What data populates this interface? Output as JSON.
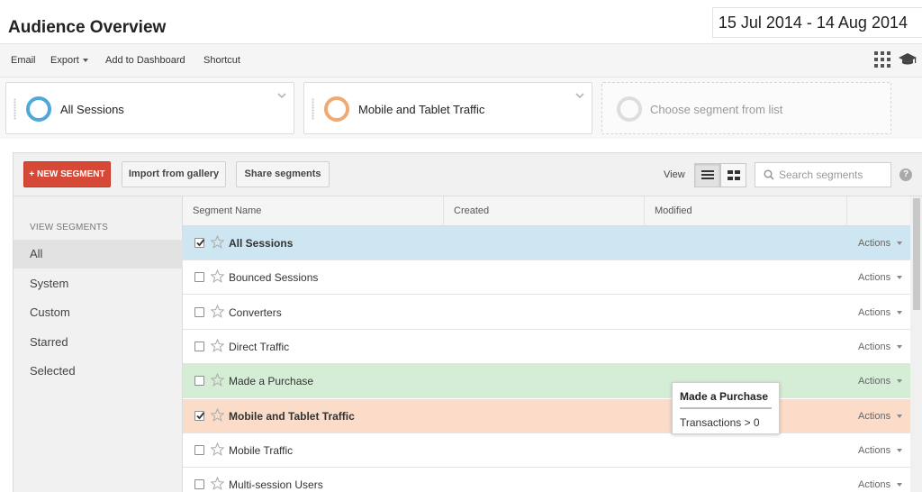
{
  "header": {
    "title": "Audience Overview",
    "date_range": "15 Jul 2014 - 14 Aug 2014"
  },
  "toolbar": {
    "email": "Email",
    "export": "Export",
    "add_to_dashboard": "Add to Dashboard",
    "shortcut": "Shortcut"
  },
  "segments": [
    {
      "label": "All Sessions",
      "color": "#4fa8d8"
    },
    {
      "label": "Mobile and Tablet Traffic",
      "color": "#f0a971"
    },
    {
      "label": "Choose segment from list",
      "color": "#dddddd"
    }
  ],
  "panel": {
    "new_segment": "+ NEW SEGMENT",
    "import_gallery": "Import from gallery",
    "share_segments": "Share segments",
    "view_label": "View",
    "search_placeholder": "Search segments",
    "help": "?"
  },
  "sidebar": {
    "heading": "VIEW SEGMENTS",
    "items": [
      "All",
      "System",
      "Custom",
      "Starred",
      "Selected"
    ]
  },
  "table": {
    "columns": [
      "Segment Name",
      "Created",
      "Modified"
    ],
    "actions_label": "Actions",
    "rows": [
      {
        "name": "All Sessions",
        "checked": true,
        "highlight": "blue"
      },
      {
        "name": "Bounced Sessions",
        "checked": false,
        "highlight": ""
      },
      {
        "name": "Converters",
        "checked": false,
        "highlight": ""
      },
      {
        "name": "Direct Traffic",
        "checked": false,
        "highlight": ""
      },
      {
        "name": "Made a Purchase",
        "checked": false,
        "highlight": "green"
      },
      {
        "name": "Mobile and Tablet Traffic",
        "checked": true,
        "highlight": "orange"
      },
      {
        "name": "Mobile Traffic",
        "checked": false,
        "highlight": ""
      },
      {
        "name": "Multi-session Users",
        "checked": false,
        "highlight": ""
      }
    ]
  },
  "tooltip": {
    "title": "Made a Purchase",
    "body": "Transactions > 0"
  }
}
